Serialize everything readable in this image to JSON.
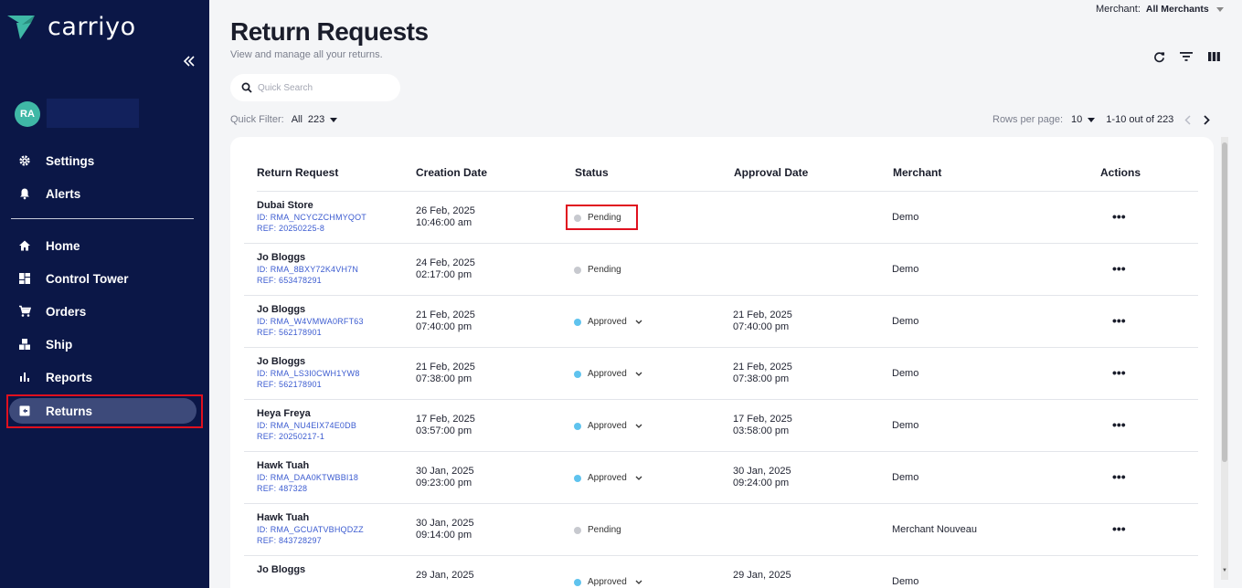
{
  "brand": {
    "logo_text": "carriyo",
    "accent": "#3fb8a6"
  },
  "user": {
    "initials": "RA"
  },
  "sidebar": {
    "top_items": [
      {
        "label": "Settings",
        "icon": "gear-icon"
      },
      {
        "label": "Alerts",
        "icon": "bell-icon"
      }
    ],
    "items": [
      {
        "label": "Home",
        "icon": "home-icon"
      },
      {
        "label": "Control Tower",
        "icon": "dashboard-icon"
      },
      {
        "label": "Orders",
        "icon": "cart-icon"
      },
      {
        "label": "Ship",
        "icon": "boxes-icon"
      },
      {
        "label": "Reports",
        "icon": "bar-chart-icon"
      },
      {
        "label": "Returns",
        "icon": "return-box-icon",
        "active": true
      }
    ]
  },
  "header": {
    "merchant_label": "Merchant:",
    "merchant_value": "All Merchants",
    "title": "Return Requests",
    "subtitle": "View and manage all your returns."
  },
  "search": {
    "placeholder": "Quick Search"
  },
  "quick_filter": {
    "label": "Quick Filter:",
    "value": "All",
    "count": "223"
  },
  "pagination": {
    "rows_label": "Rows per page:",
    "rows_value": "10",
    "range": "1-10 out of 223"
  },
  "table": {
    "headers": [
      "Return Request",
      "Creation Date",
      "Status",
      "Approval Date",
      "Merchant",
      "Actions"
    ],
    "rows": [
      {
        "name": "Dubai Store",
        "id": "ID: RMA_NCYCZCHMYQOT",
        "ref": "REF: 20250225-8",
        "created_date": "26 Feb, 2025",
        "created_time": "10:46:00 am",
        "status": "Pending",
        "approval_date": "",
        "approval_time": "",
        "merchant": "Demo",
        "actions": "•••"
      },
      {
        "name": "Jo Bloggs",
        "id": "ID: RMA_8BXY72K4VH7N",
        "ref": "REF: 653478291",
        "created_date": "24 Feb, 2025",
        "created_time": "02:17:00 pm",
        "status": "Pending",
        "approval_date": "",
        "approval_time": "",
        "merchant": "Demo",
        "actions": "•••"
      },
      {
        "name": "Jo Bloggs",
        "id": "ID: RMA_W4VMWA0RFT63",
        "ref": "REF: 562178901",
        "created_date": "21 Feb, 2025",
        "created_time": "07:40:00 pm",
        "status": "Approved",
        "approval_date": "21 Feb, 2025",
        "approval_time": "07:40:00 pm",
        "merchant": "Demo",
        "actions": "•••"
      },
      {
        "name": "Jo Bloggs",
        "id": "ID: RMA_LS3I0CWH1YW8",
        "ref": "REF: 562178901",
        "created_date": "21 Feb, 2025",
        "created_time": "07:38:00 pm",
        "status": "Approved",
        "approval_date": "21 Feb, 2025",
        "approval_time": "07:38:00 pm",
        "merchant": "Demo",
        "actions": "•••"
      },
      {
        "name": "Heya Freya",
        "id": "ID: RMA_NU4EIX74E0DB",
        "ref": "REF: 20250217-1",
        "created_date": "17 Feb, 2025",
        "created_time": "03:57:00 pm",
        "status": "Approved",
        "approval_date": "17 Feb, 2025",
        "approval_time": "03:58:00 pm",
        "merchant": "Demo",
        "actions": "•••"
      },
      {
        "name": "Hawk Tuah",
        "id": "ID: RMA_DAA0KTWBBI18",
        "ref": "REF: 487328",
        "created_date": "30 Jan, 2025",
        "created_time": "09:23:00 pm",
        "status": "Approved",
        "approval_date": "30 Jan, 2025",
        "approval_time": "09:24:00 pm",
        "merchant": "Demo",
        "actions": "•••"
      },
      {
        "name": "Hawk Tuah",
        "id": "ID: RMA_GCUATVBHQDZZ",
        "ref": "REF: 843728297",
        "created_date": "30 Jan, 2025",
        "created_time": "09:14:00 pm",
        "status": "Pending",
        "approval_date": "",
        "approval_time": "",
        "merchant": "Merchant Nouveau",
        "actions": "•••"
      },
      {
        "name": "Jo Bloggs",
        "id": "",
        "ref": "",
        "created_date": "29 Jan, 2025",
        "created_time": "",
        "status": "Approved",
        "approval_date": "29 Jan, 2025",
        "approval_time": "",
        "merchant": "Demo",
        "actions": ""
      }
    ]
  },
  "colors": {
    "sidebar_bg": "#0b1747",
    "pending_dot": "#c7c9cf",
    "approved_dot": "#5fc3ee",
    "link_blue": "#3b5bd0",
    "highlight": "#e0101e"
  }
}
